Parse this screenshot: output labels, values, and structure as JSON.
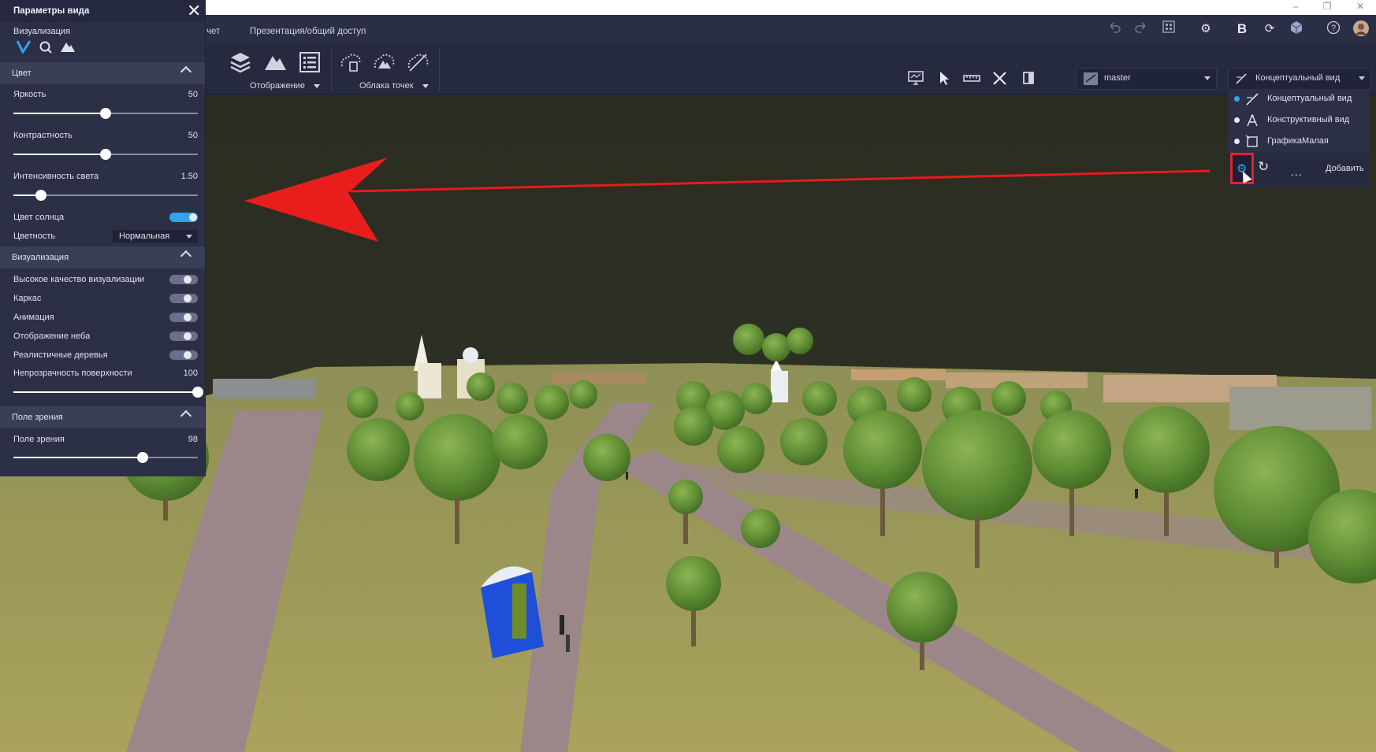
{
  "window": {
    "minimize": "–",
    "restore": "❐",
    "close": "✕"
  },
  "app": {
    "tabs": [
      "чет",
      "Презентация/общий доступ"
    ],
    "top_icons": [
      "undo-icon",
      "redo-icon",
      "grid-icon",
      "gear-icon",
      "bold-b-icon",
      "refresh-icon",
      "package-icon",
      "help-icon",
      "user-avatar"
    ]
  },
  "ribbon": {
    "display_label": "Отображение",
    "pointclouds_label": "Облака точек",
    "branch_value": "master",
    "view_value": "Концептуальный вид"
  },
  "views_menu": {
    "items": [
      {
        "label": "Концептуальный вид",
        "active": true,
        "icon": "pencil-icon"
      },
      {
        "label": "Конструктивный вид",
        "active": false,
        "icon": "compass-icon"
      },
      {
        "label": "ГрафикаМалая",
        "active": false,
        "icon": "frame-icon"
      }
    ],
    "add_label": "Добавить",
    "more_label": "..."
  },
  "panel": {
    "title": "Параметры вида",
    "visualization_label": "Визуализация",
    "color_section": "Цвет",
    "brightness_label": "Яркость",
    "brightness_value": "50",
    "brightness_level": 0.5,
    "contrast_label": "Контрастность",
    "contrast_value": "50",
    "contrast_level": 0.5,
    "light_label": "Интенсивность света",
    "light_value": "1.50",
    "light_level": 0.15,
    "sun_color_label": "Цвет солнца",
    "sun_color_on": true,
    "chroma_label": "Цветность",
    "chroma_value": "Нормальная",
    "vis_section": "Визуализация",
    "hq_label": "Высокое качество визуализации",
    "wireframe_label": "Каркас",
    "animation_label": "Анимация",
    "sky_label": "Отображение неба",
    "trees_label": "Реалистичные деревья",
    "opacity_label": "Непрозрачность поверхности",
    "opacity_value": "100",
    "opacity_level": 1.0,
    "fov_section": "Поле зрения",
    "fov_label": "Поле зрения",
    "fov_value": "98",
    "fov_level": 0.7
  },
  "colors": {
    "accent": "#2da6f0",
    "highlight": "#e02424",
    "panel": "#2b3047"
  }
}
